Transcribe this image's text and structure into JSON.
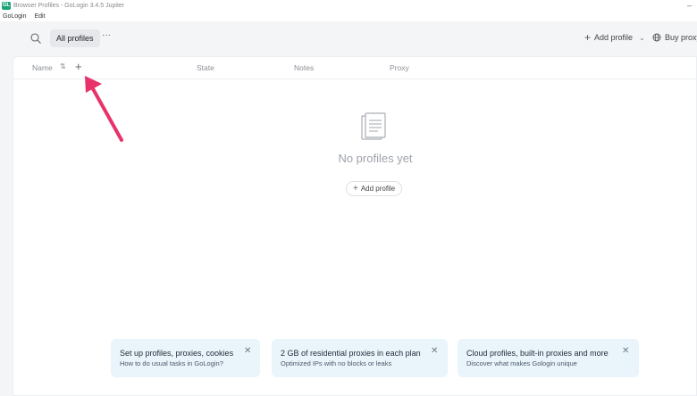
{
  "window": {
    "logo": "GL",
    "title": "Browser Profiles - GoLogin 3.4.5 Jupiter",
    "minimize": "–"
  },
  "menu": [
    "GoLogin",
    "Edit"
  ],
  "toolbar": {
    "tab_label": "All profiles",
    "more": "···",
    "add_profile_label": "Add profile",
    "buy_proxy_label": "Buy proxy"
  },
  "table": {
    "columns": [
      "Name",
      "State",
      "Notes",
      "Proxy"
    ]
  },
  "empty_state": {
    "message": "No profiles yet",
    "add_button_label": "Add profile"
  },
  "cards": [
    {
      "title": "Set up profiles, proxies, cookies",
      "subtitle": "How to do usual tasks in GoLogin?"
    },
    {
      "title": "2 GB of residential proxies in each plan",
      "subtitle": "Optimized IPs with no blocks or leaks"
    },
    {
      "title": "Cloud profiles, built-in proxies and more",
      "subtitle": "Discover what makes Gologin unique"
    }
  ],
  "colors": {
    "accent": "#1aa37a",
    "card_bg": "#e9f4fb",
    "annotation_arrow": "#e8336a"
  },
  "icons": [
    "search-icon",
    "more-icon",
    "plus-icon",
    "chevron-down-icon",
    "globe-icon",
    "sort-icon",
    "document-icon",
    "close-icon"
  ]
}
